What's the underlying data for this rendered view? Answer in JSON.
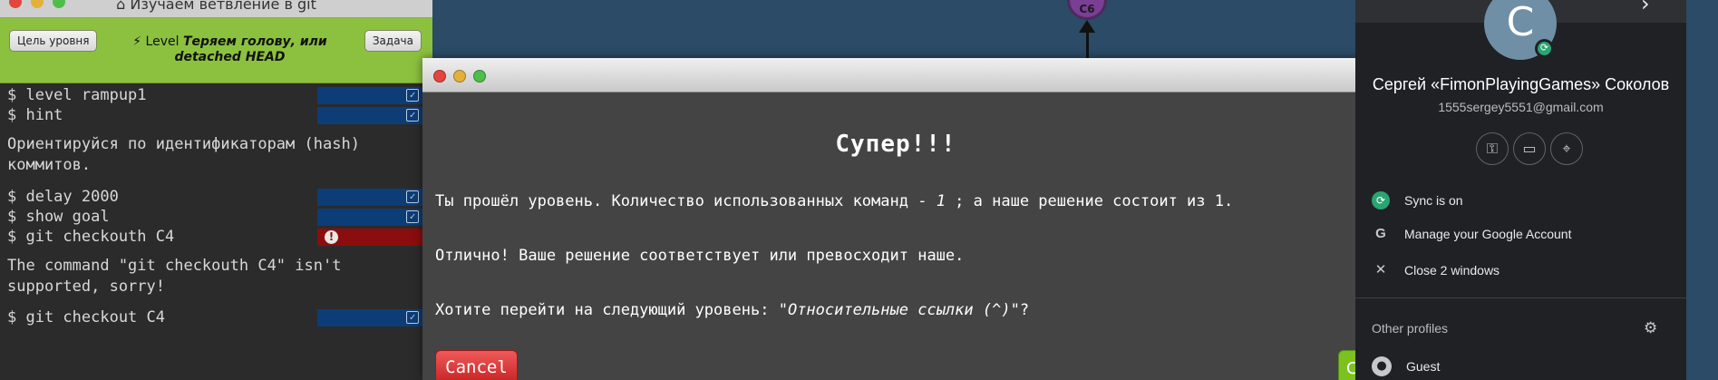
{
  "window": {
    "title": "⌂ Изучаем ветвление в git",
    "dot_colors": [
      "#e2463e",
      "#e3b13a",
      "#4ebe4b"
    ]
  },
  "level_bar": {
    "goal_button": "Цель уровня",
    "task_button": "Задача",
    "level_prefix": "⚡ Level",
    "level_name": "Теряем голову, или detached HEAD",
    "bg_color": "#8cc13f"
  },
  "terminal": {
    "commands": [
      {
        "text": "$ level rampup1",
        "status": "ok"
      },
      {
        "text": "$ hint",
        "status": "ok"
      }
    ],
    "hint_message": "Ориентируйся по идентификаторам (hash)\nкоммитов.",
    "commands2": [
      {
        "text": "$ delay 2000",
        "status": "ok"
      },
      {
        "text": "$ show goal",
        "status": "ok"
      },
      {
        "text": "$ git checkouth C4",
        "status": "error"
      }
    ],
    "error_message": "The command \"git checkouth C4\" isn't\nsupported, sorry!",
    "commands3": [
      {
        "text": "$ git checkout C4",
        "status": "ok"
      }
    ],
    "check_glyph": "✓",
    "error_glyph": "!"
  },
  "graph": {
    "node_label": "C6",
    "node_color": "#7a3e95"
  },
  "modal": {
    "heading": "Супер!!!",
    "line1_prefix": "Ты прошёл уровень. Количество использованных команд - ",
    "line1_count": "1",
    "line1_suffix": " ; а наше решение состоит из 1.",
    "line2": "Отлично! Ваше решение соответствует или превосходит наше.",
    "line3_prefix": "Хотите перейти на следующий уровень: ",
    "line3_level": "\"Относительные ссылки (^)\"",
    "line3_suffix": "?",
    "cancel_label": "Cancel",
    "ok_label_partial": "C"
  },
  "profile": {
    "avatar_letter": "C",
    "name": "Сергей «FimonPlayingGames» Соколов",
    "email": "1555sergey5551@gmail.com",
    "menu": [
      {
        "icon": "sync-icon",
        "glyph": "⟳",
        "label": "Sync is on"
      },
      {
        "icon": "google-icon",
        "glyph": "G",
        "label": "Manage your Google Account"
      },
      {
        "icon": "close-icon",
        "glyph": "✕",
        "label": "Close 2 windows"
      }
    ],
    "other_profiles_label": "Other profiles",
    "guest_label": "Guest",
    "accent_sync": "#2aa571"
  }
}
